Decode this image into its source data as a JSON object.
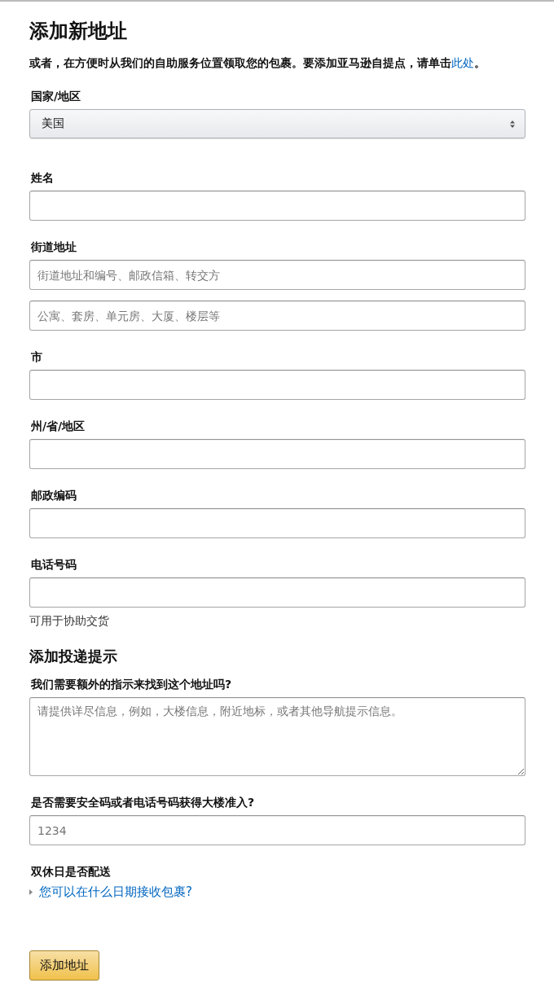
{
  "title": "添加新地址",
  "intro": {
    "text": "或者，在方便时从我们的自助服务位置领取您的包裹。要添加亚马逊自提点，请单击",
    "link": "此处",
    "end": "。"
  },
  "fields": [
    {
      "kind": "select",
      "label": "国家/地区",
      "value": "美国"
    },
    {
      "kind": "text",
      "label": "姓名"
    },
    {
      "kind": "multi",
      "label": "街道地址",
      "placeholders": [
        "街道地址和编号、邮政信箱、转交方",
        "公寓、套房、单元房、大厦、楼层等"
      ]
    },
    {
      "kind": "text",
      "label": "市"
    },
    {
      "kind": "text",
      "label": "州/省/地区"
    },
    {
      "kind": "text",
      "label": "邮政编码"
    },
    {
      "kind": "text",
      "label": "电话号码",
      "hint": "可用于协助交货"
    }
  ],
  "delivery": {
    "heading": "添加投递提示",
    "fields": [
      {
        "kind": "textarea",
        "label": "我们需要额外的指示来找到这个地址吗?",
        "placeholder": "请提供详尽信息，例如，大楼信息，附近地标，或者其他导航提示信息。"
      },
      {
        "kind": "text",
        "label": "是否需要安全码或者电话号码获得大楼准入?",
        "placeholder": "1234"
      },
      {
        "kind": "disclosure",
        "label": "双休日是否配送",
        "link": "您可以在什么日期接收包裹?",
        "expanded": false
      }
    ]
  },
  "submit": "添加地址"
}
